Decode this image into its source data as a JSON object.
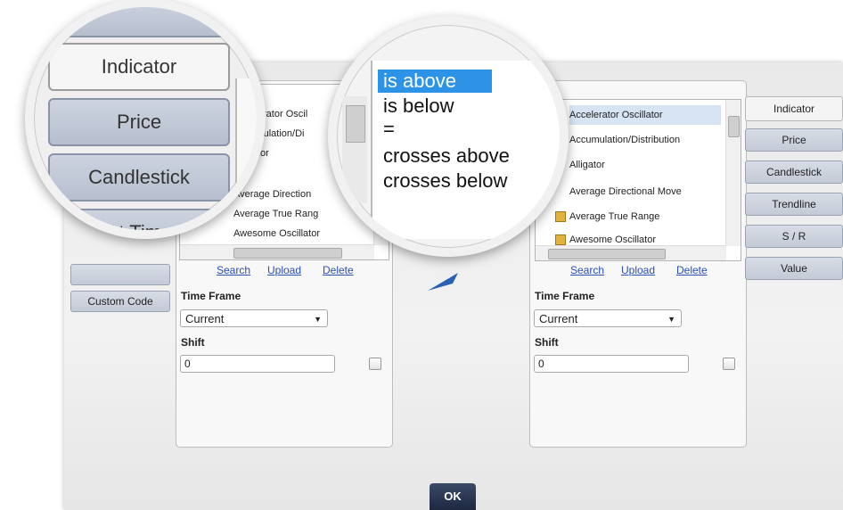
{
  "left_tabs": {
    "custom_code": "Custom Code"
  },
  "left_panel": {
    "items": [
      "Accelerator Oscil",
      "Accumulation/Di",
      "Alligator",
      "Average Direction",
      "Average True Rang",
      "Awesome Oscillator"
    ],
    "links": {
      "search": "Search",
      "upload": "Upload",
      "delete": "Delete"
    },
    "time_frame_label": "Time Frame",
    "time_frame_value": "Current",
    "shift_label": "Shift",
    "shift_value": "0"
  },
  "right_panel": {
    "items": [
      "Accelerator Oscillator",
      "Accumulation/Distribution",
      "Alligator",
      "Average Directional Move",
      "Average True Range",
      "Awesome Oscillator"
    ],
    "links": {
      "search": "Search",
      "upload": "Upload",
      "delete": "Delete"
    },
    "time_frame_label": "Time Frame",
    "time_frame_value": "Current",
    "shift_label": "Shift",
    "shift_value": "0"
  },
  "right_tabs": [
    "Indicator",
    "Price",
    "Candlestick",
    "Trendline",
    "S / R",
    "Value"
  ],
  "ok_label": "OK",
  "magnifier_tabs": [
    "Indicator",
    "Price",
    "Candlestick",
    "At Time"
  ],
  "operators": [
    "is above",
    "is below",
    "=",
    "crosses above",
    "crosses below"
  ],
  "colors": {
    "accent": "#2c93e6",
    "ok_button": "#2a3754",
    "link": "#2a4fb6"
  }
}
